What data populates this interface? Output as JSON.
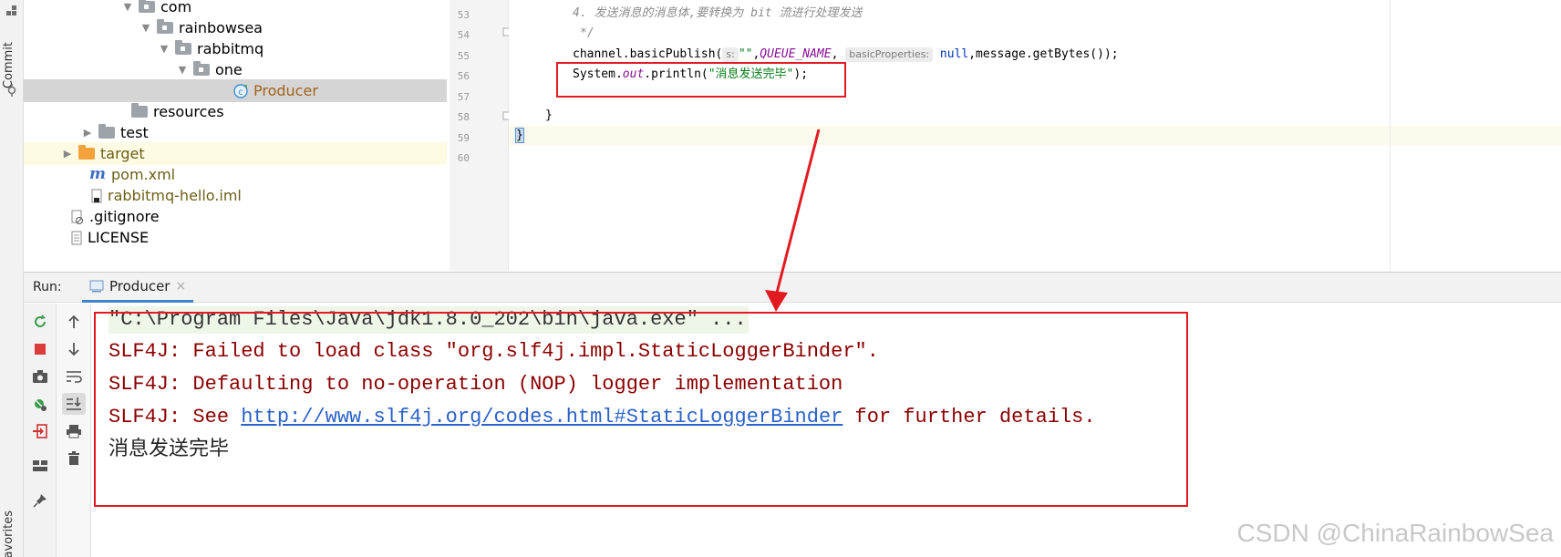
{
  "sidebar": {
    "commit_label": "Commit",
    "favorites_label": "Favorites"
  },
  "tree": {
    "items": [
      {
        "label": "com"
      },
      {
        "label": "rainbowsea"
      },
      {
        "label": "rabbitmq"
      },
      {
        "label": "one"
      },
      {
        "label": "Producer"
      },
      {
        "label": "resources"
      },
      {
        "label": "test"
      },
      {
        "label": "target"
      },
      {
        "label": "pom.xml"
      },
      {
        "label": "rabbitmq-hello.iml"
      },
      {
        "label": ".gitignore"
      },
      {
        "label": "LICENSE"
      }
    ]
  },
  "editor": {
    "line_numbers": [
      "53",
      "54",
      "55",
      "56",
      "57",
      "58",
      "59",
      "60"
    ],
    "comment_line": "4. 发送消息的消息体,要转换为 bit 流进行处理发送",
    "comment_end": "*/",
    "publish": {
      "prefix": "channel.basicPublish(",
      "hint_s": "s:",
      "exchange": "\"\"",
      "comma1": ",",
      "queue_const": "QUEUE_NAME",
      "comma2": ",",
      "hint_props": "basicProperties:",
      "null_kw": "null",
      "suffix": ",message.getBytes());"
    },
    "println": {
      "prefix": "System.",
      "out": "out",
      "method": ".println(",
      "str": "\"消息发送完毕\"",
      "suffix": ");"
    },
    "close_brace_inner": "}",
    "close_brace_outer": "}"
  },
  "run": {
    "label": "Run:",
    "tab_label": "Producer",
    "tab_close": "×",
    "console": {
      "cmd": "\"C:\\Program Files\\Java\\jdk1.8.0_202\\bin\\java.exe\" ...",
      "err1": "SLF4J: Failed to load class \"org.slf4j.impl.StaticLoggerBinder\".",
      "err2": "SLF4J: Defaulting to no-operation (NOP) logger implementation",
      "err3_prefix": "SLF4J: See ",
      "err3_link": "http://www.slf4j.org/codes.html#StaticLoggerBinder",
      "err3_suffix": " for further details.",
      "output": "消息发送完毕"
    }
  },
  "watermark": "CSDN @ChinaRainbowSea",
  "colors": {
    "annotation_red": "#e21a22",
    "error_text": "#8b0000",
    "link": "#2a62c9",
    "tab_accent": "#4083c9"
  }
}
